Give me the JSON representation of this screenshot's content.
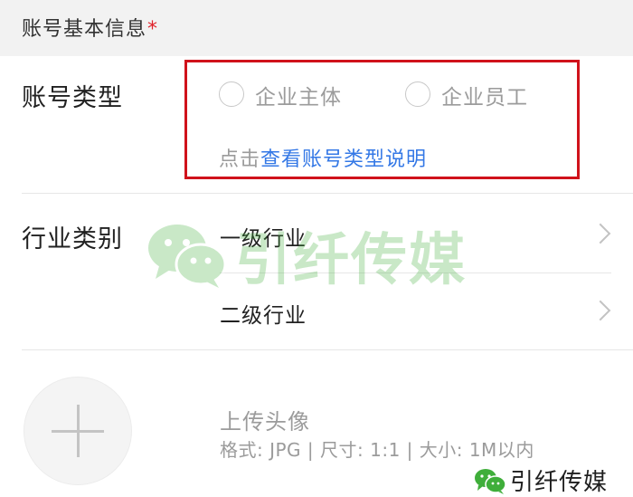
{
  "section": {
    "title": "账号基本信息",
    "required_mark": "*"
  },
  "account_type": {
    "label": "账号类型",
    "options": [
      {
        "label": "企业主体",
        "selected": false
      },
      {
        "label": "企业员工",
        "selected": false
      }
    ],
    "help_prefix": "点击",
    "help_link": "查看账号类型说明"
  },
  "industry": {
    "label": "行业类别",
    "items": [
      {
        "label": "一级行业"
      },
      {
        "label": "二级行业"
      }
    ]
  },
  "avatar": {
    "title": "上传头像",
    "hint": "格式: JPG | 尺寸: 1:1 | 大小: 1M以内"
  },
  "watermark": {
    "text": "引纤传媒"
  },
  "brand": {
    "text": "引纤传媒"
  },
  "colors": {
    "highlight": "#d0121b",
    "link": "#3478e6",
    "required": "#e0212a",
    "wechat_green": "#3fae3a"
  }
}
